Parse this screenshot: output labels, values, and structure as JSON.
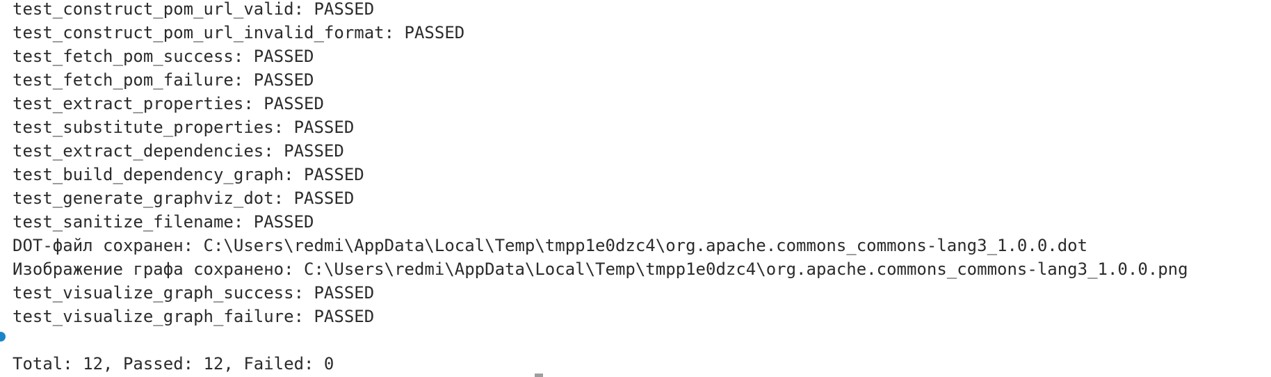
{
  "terminal": {
    "lines": [
      "test_construct_pom_url_valid: PASSED",
      "test_construct_pom_url_invalid_format: PASSED",
      "test_fetch_pom_success: PASSED",
      "test_fetch_pom_failure: PASSED",
      "test_extract_properties: PASSED",
      "test_substitute_properties: PASSED",
      "test_extract_dependencies: PASSED",
      "test_build_dependency_graph: PASSED",
      "test_generate_graphviz_dot: PASSED",
      "test_sanitize_filename: PASSED",
      "DOT-файл сохранен: C:\\Users\\redmi\\AppData\\Local\\Temp\\tmpp1e0dzc4\\org.apache.commons_commons-lang3_1.0.0.dot",
      "Изображение графа сохранено: C:\\Users\\redmi\\AppData\\Local\\Temp\\tmpp1e0dzc4\\org.apache.commons_commons-lang3_1.0.0.png",
      "test_visualize_graph_success: PASSED",
      "test_visualize_graph_failure: PASSED"
    ],
    "summary": "Total: 12, Passed: 12, Failed: 0",
    "decoration_color": "#1a85c8",
    "text_color": "#2b2b2b",
    "background": "#ffffff"
  }
}
